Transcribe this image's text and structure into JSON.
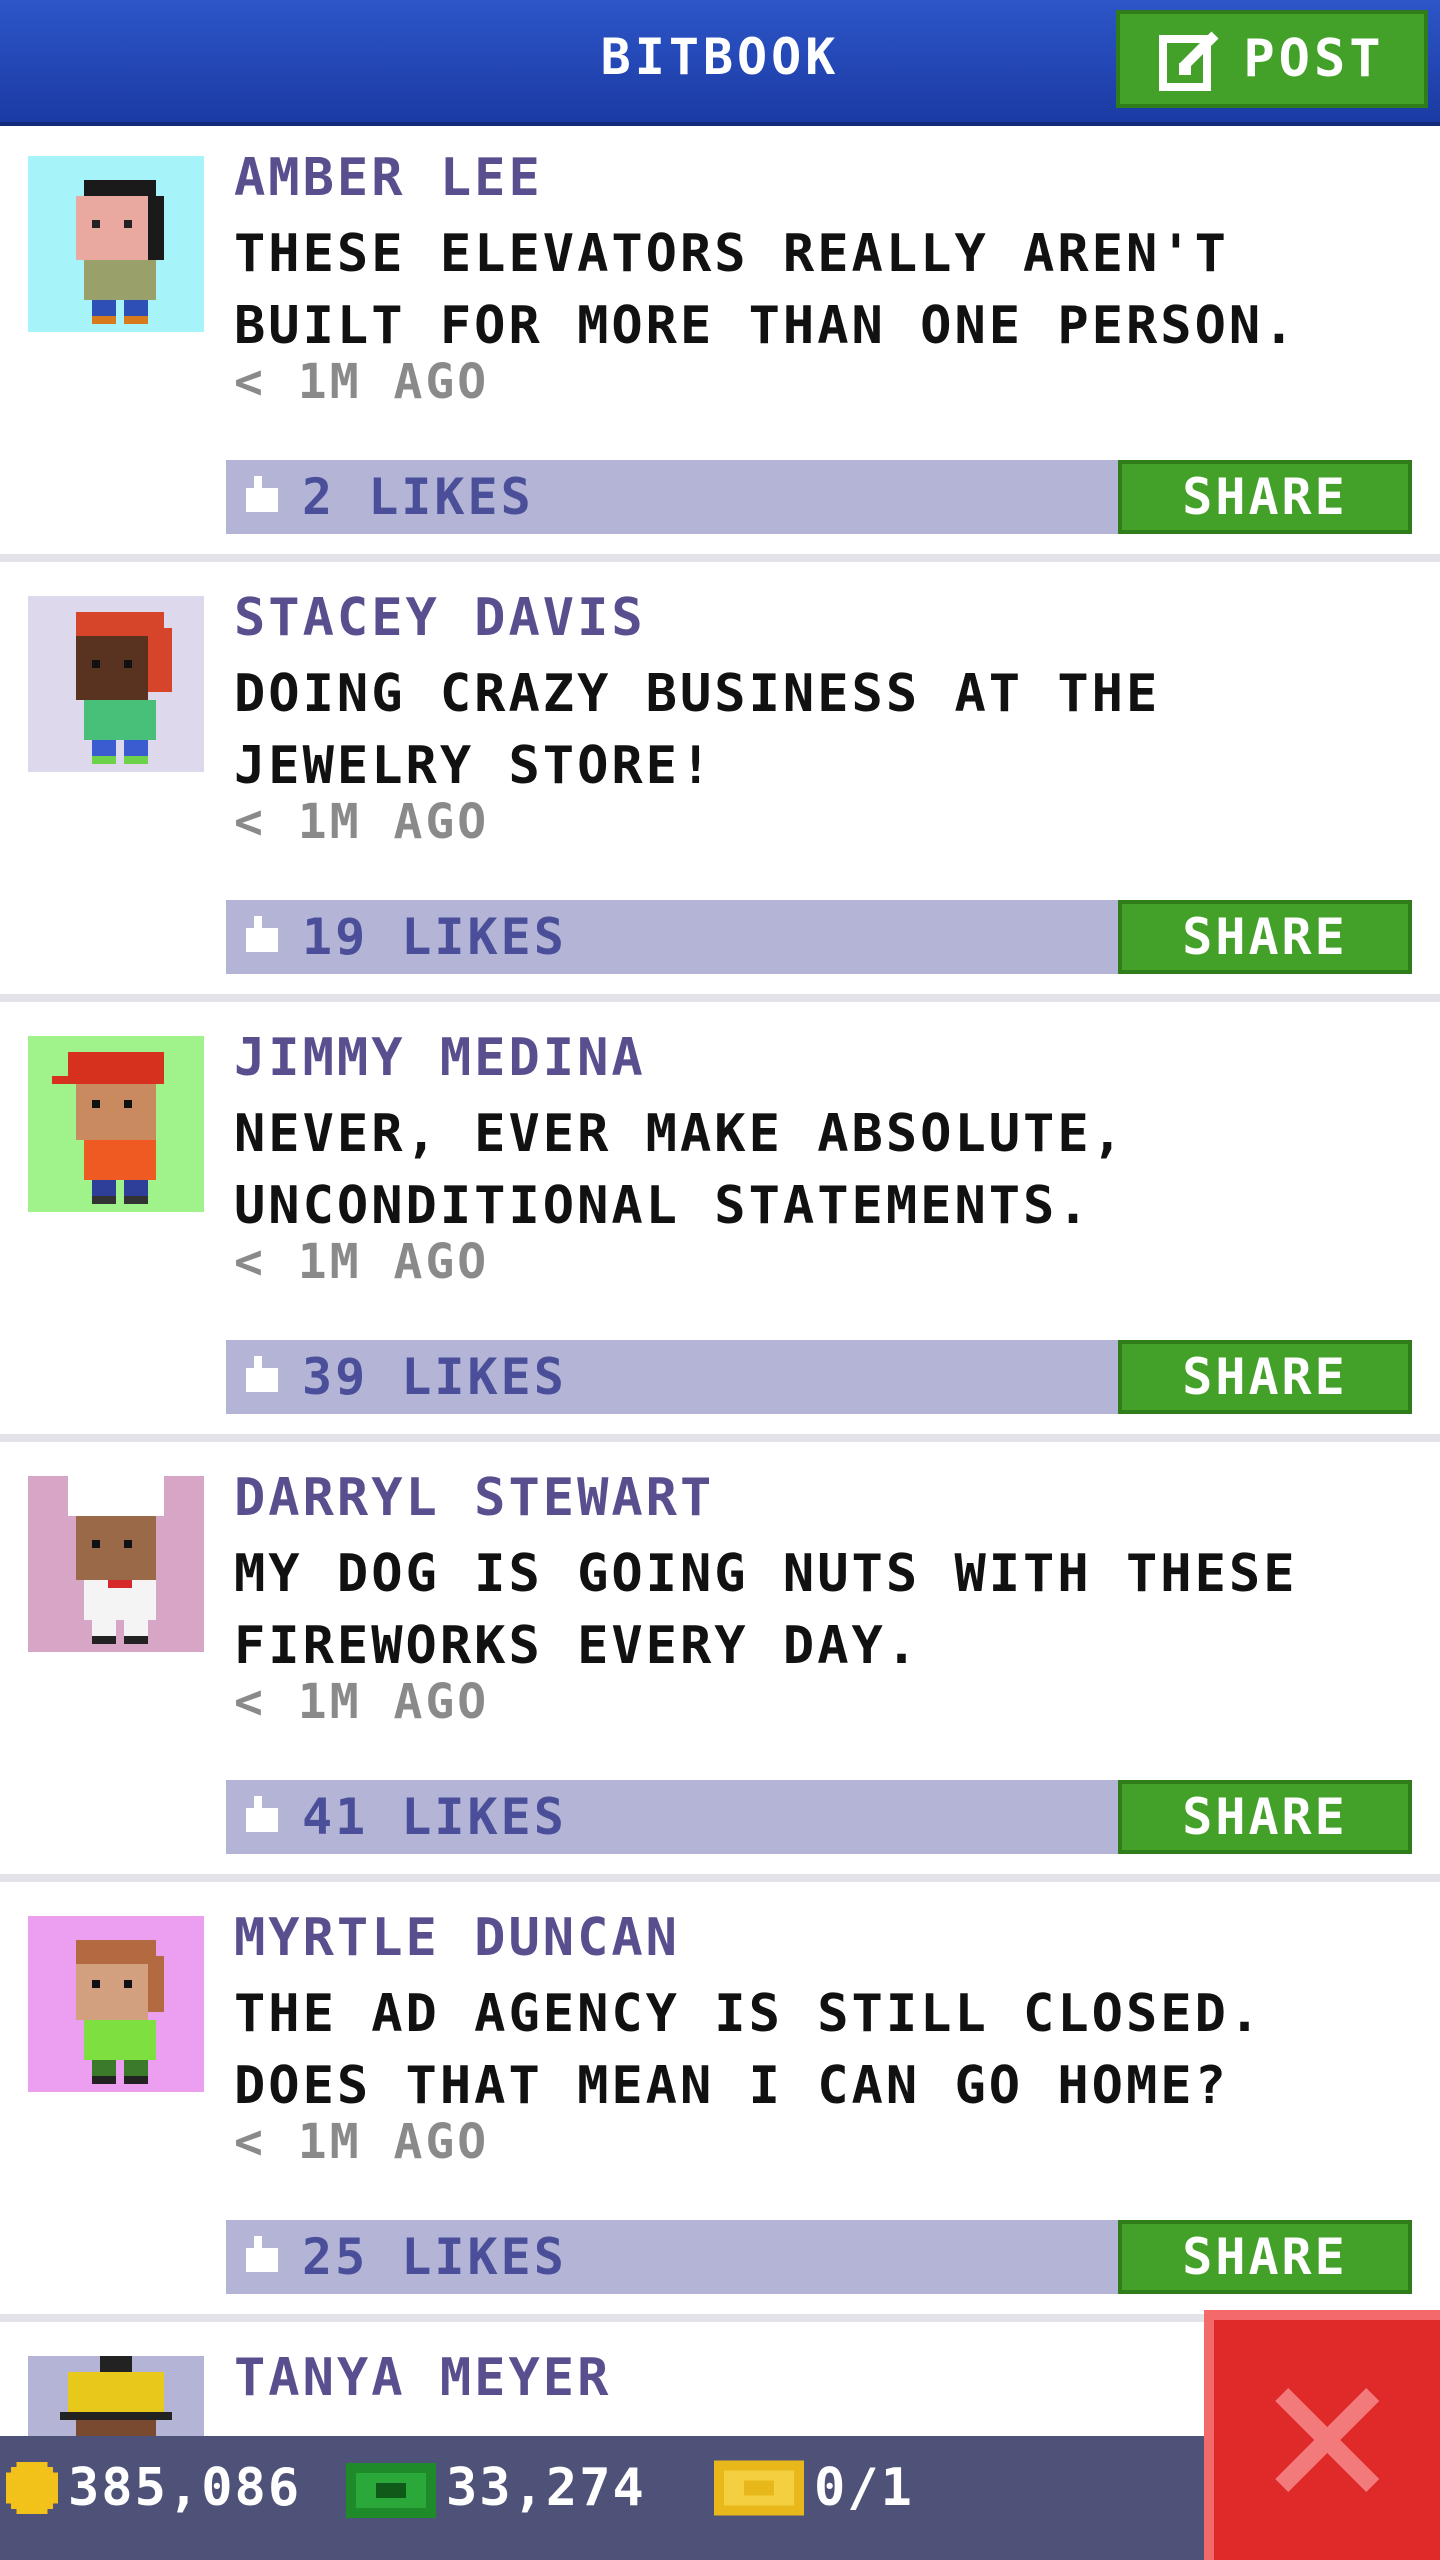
{
  "header": {
    "title": "BITBOOK",
    "post_label": "POST"
  },
  "feed": [
    {
      "author": "AMBER LEE",
      "message": "THESE ELEVATORS REALLY AREN'T BUILT FOR MORE THAN ONE PERSON.",
      "time": "< 1M AGO",
      "likes": "2 LIKES",
      "share_label": "SHARE",
      "avatar_bg": "#a6f4fa"
    },
    {
      "author": "STACEY DAVIS",
      "message": "DOING CRAZY BUSINESS AT THE JEWELRY STORE!",
      "time": "< 1M AGO",
      "likes": "19 LIKES",
      "share_label": "SHARE",
      "avatar_bg": "#ddd8ec"
    },
    {
      "author": "JIMMY MEDINA",
      "message": "NEVER, EVER MAKE ABSOLUTE, UNCONDITIONAL STATEMENTS.",
      "time": "< 1M AGO",
      "likes": "39 LIKES",
      "share_label": "SHARE",
      "avatar_bg": "#a0f28a"
    },
    {
      "author": "DARRYL STEWART",
      "message": "MY DOG IS GOING NUTS WITH THESE FIREWORKS EVERY DAY.",
      "time": "< 1M AGO",
      "likes": "41 LIKES",
      "share_label": "SHARE",
      "avatar_bg": "#d7a6c6"
    },
    {
      "author": "MYRTLE DUNCAN",
      "message": "THE AD AGENCY IS STILL CLOSED. DOES THAT MEAN I CAN GO HOME?",
      "time": "< 1M AGO",
      "likes": "25 LIKES",
      "share_label": "SHARE",
      "avatar_bg": "#ec9ef0"
    },
    {
      "author": "TANYA MEYER",
      "avatar_bg": "#b3b4d6"
    }
  ],
  "status_bar": {
    "coins": "385,086",
    "bux": "33,274",
    "tickets": "0/1"
  },
  "icons": {
    "post": "edit-icon",
    "like": "thumbs-up-icon",
    "coin": "coin-icon",
    "bux": "cash-icon",
    "ticket": "ticket-icon",
    "close": "close-icon"
  },
  "colors": {
    "header": "#1b3aa3",
    "accent_green": "#43a12a",
    "likes_bar": "#b3b4d6",
    "author_text": "#5a4f8e",
    "close_red": "#e02a2a"
  }
}
